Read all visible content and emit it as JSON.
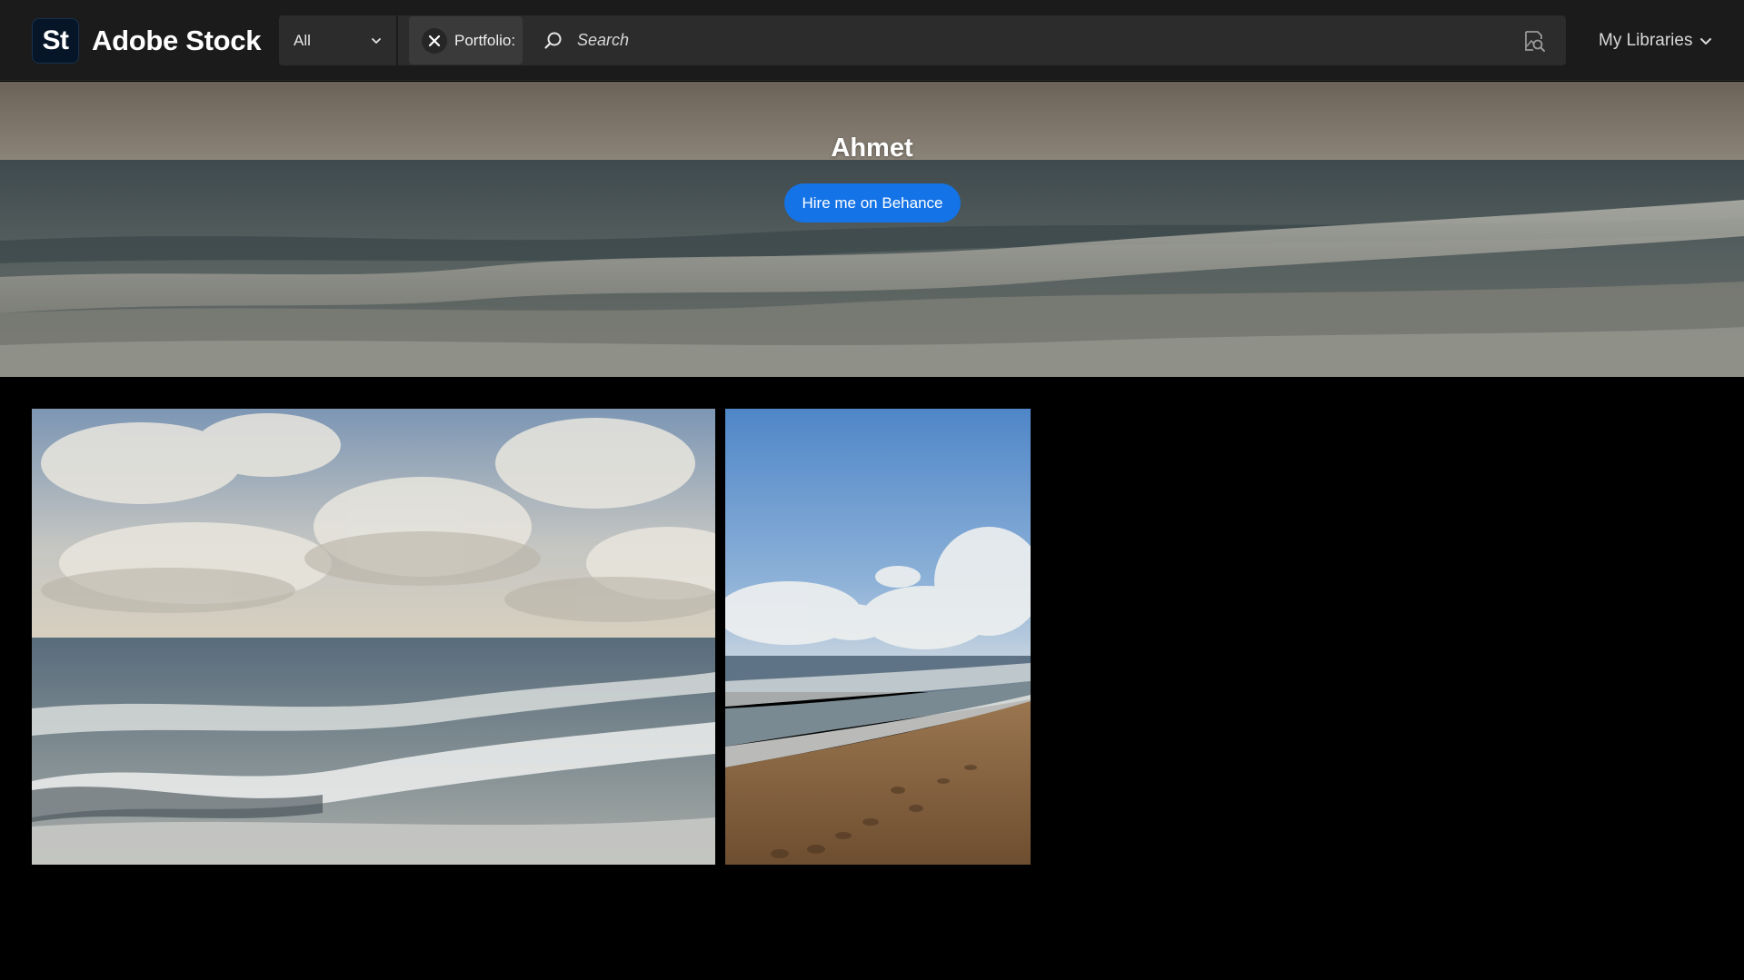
{
  "header": {
    "logo_badge": "St",
    "logo_text": "Adobe Stock",
    "filter": {
      "selected": "All"
    },
    "portfolio_chip": "Portfolio:",
    "search": {
      "placeholder": "Search",
      "value": ""
    },
    "libraries_label": "My Libraries"
  },
  "hero": {
    "contributor_name": "Ahmet",
    "hire_button_label": "Hire me on Behance"
  },
  "gallery": {
    "items": [
      {
        "description": "sea waves under cloudy sky"
      },
      {
        "description": "beach with footprints and blue sky"
      }
    ]
  },
  "colors": {
    "accent": "#1473e6",
    "header_bg": "#1b1b1b",
    "page_bg": "#000000"
  }
}
